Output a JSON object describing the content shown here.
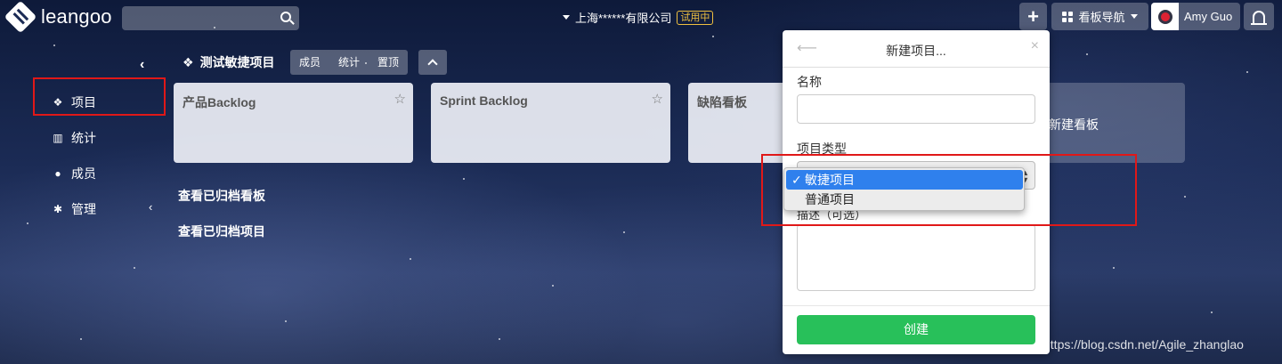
{
  "topbar": {
    "logo_text": "leangoo",
    "company": "上海******有限公司",
    "trial_badge": "试用中",
    "plus_label": "+",
    "board_nav_label": "看板导航",
    "user_name": "Amy Guo"
  },
  "sidebar": {
    "collapse_icon": "chevron-left-icon",
    "items": [
      {
        "label": "项目",
        "icon": "cubes-icon"
      },
      {
        "label": "统计",
        "icon": "bar-chart-icon"
      },
      {
        "label": "成员",
        "icon": "users-icon"
      },
      {
        "label": "管理",
        "icon": "gear-icon"
      }
    ]
  },
  "project": {
    "title": "测试敏捷项目",
    "tabs": [
      "成员",
      "统计",
      "置顶"
    ]
  },
  "boards": [
    {
      "name": "产品Backlog"
    },
    {
      "name": "Sprint Backlog"
    },
    {
      "name": "缺陷看板"
    }
  ],
  "new_board_label": "新建看板",
  "archive_links": [
    "查看已归档看板",
    "查看已归档项目"
  ],
  "popup": {
    "title": "新建项目...",
    "name_label": "名称",
    "name_value": "",
    "type_label": "项目类型",
    "desc_label": "描述（可选）",
    "create_label": "创建"
  },
  "dropdown": {
    "selected": "敏捷项目",
    "check": "✓",
    "options": [
      "敏捷项目",
      "普通项目"
    ]
  },
  "watermark": "https://blog.csdn.net/Agile_zhanglao",
  "colors": {
    "accent_green": "#28c05a",
    "select_blue": "#2f80ed",
    "highlight_red": "#e01818",
    "trial_yellow": "#f0c040"
  }
}
